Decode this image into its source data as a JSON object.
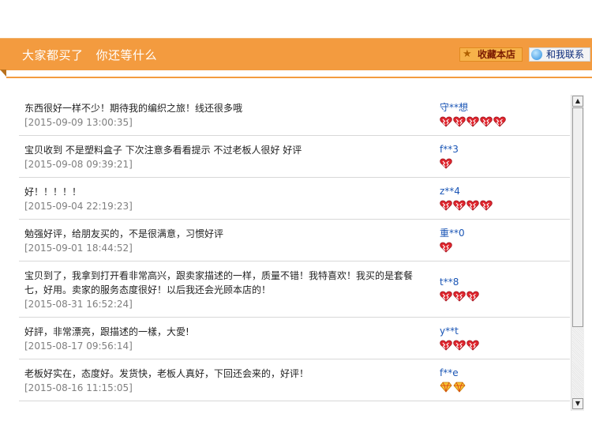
{
  "header": {
    "title_part1": "大家都买了",
    "title_part2": "你还等什么",
    "fav_label": "收藏本店",
    "contact_label": "和我联系",
    "accent_color": "#f39b3f"
  },
  "reviews": [
    {
      "comment": "东西很好一样不少！期待我的编织之旅！线还很多哦",
      "date": "[2015-09-09 13:00:35]",
      "user": "守**想",
      "rank_icon": "heart",
      "rank_count": 5
    },
    {
      "comment": "宝贝收到 不是塑料盒子 下次注意多看看提示 不过老板人很好 好评",
      "date": "[2015-09-08 09:39:21]",
      "user": "f**3",
      "rank_icon": "heart",
      "rank_count": 1
    },
    {
      "comment": "好！！！！！",
      "date": "[2015-09-04 22:19:23]",
      "user": "z**4",
      "rank_icon": "heart",
      "rank_count": 4
    },
    {
      "comment": "勉强好评，给朋友买的，不是很满意，习惯好评",
      "date": "[2015-09-01 18:44:52]",
      "user": "重**0",
      "rank_icon": "heart",
      "rank_count": 1
    },
    {
      "comment": "宝贝到了，我拿到打开看非常高兴，跟卖家描述的一样，质量不错！我特喜欢！我买的是套餐七，好用。卖家的服务态度很好！以后我还会光顾本店的！",
      "date": "[2015-08-31 16:52:24]",
      "user": "t**8",
      "rank_icon": "heart",
      "rank_count": 3
    },
    {
      "comment": "好評，非常漂亮，跟描述的一樣，大愛!",
      "date": "[2015-08-17 09:56:14]",
      "user": "y**t",
      "rank_icon": "heart",
      "rank_count": 3
    },
    {
      "comment": "老板好实在，态度好。发货快，老板人真好，下回还会来的，好评！",
      "date": "[2015-08-16 11:15:05]",
      "user": "f**e",
      "rank_icon": "diamond",
      "rank_count": 2
    }
  ]
}
